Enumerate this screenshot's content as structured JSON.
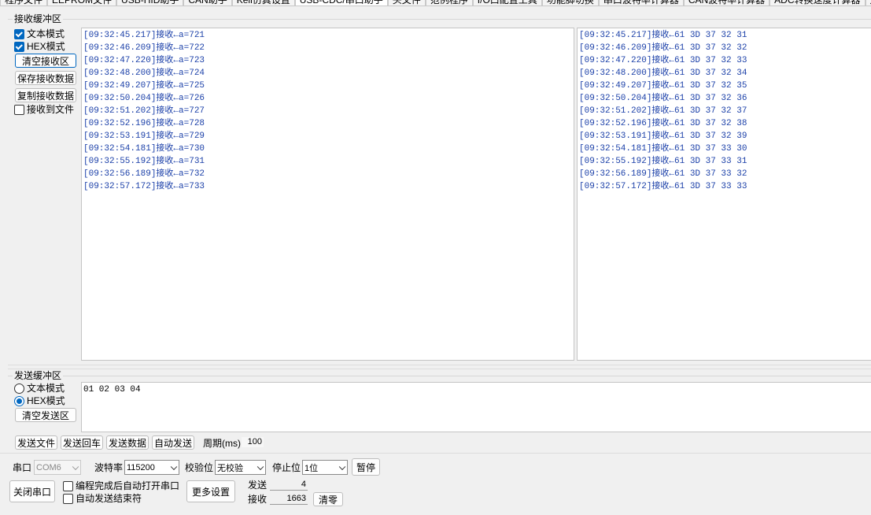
{
  "tabs": [
    "程序文件",
    "EEPROM文件",
    "USB-HID助手",
    "CAN助手",
    "Keil仿真设置",
    "USB-CDC/串口助手",
    "头文件",
    "范例程序",
    "I/O口配置工具",
    "功能脚切换",
    "串口波特率计算器",
    "CAN波特率计算器",
    "ADC转换速度计算器",
    "定时器计算"
  ],
  "active_tab_index": 5,
  "receive": {
    "group_title": "接收缓冲区",
    "text_mode_label": "文本模式",
    "text_mode_checked": true,
    "hex_mode_label": "HEX模式",
    "hex_mode_checked": true,
    "clear_button": "清空接收区",
    "save_button": "保存接收数据",
    "copy_button": "复制接收数据",
    "to_file_label": "接收到文件",
    "to_file_checked": false,
    "text_lines": [
      "[09:32:45.217]接收←a=721",
      "[09:32:46.209]接收←a=722",
      "[09:32:47.220]接收←a=723",
      "[09:32:48.200]接收←a=724",
      "[09:32:49.207]接收←a=725",
      "[09:32:50.204]接收←a=726",
      "[09:32:51.202]接收←a=727",
      "[09:32:52.196]接收←a=728",
      "[09:32:53.191]接收←a=729",
      "[09:32:54.181]接收←a=730",
      "[09:32:55.192]接收←a=731",
      "[09:32:56.189]接收←a=732",
      "[09:32:57.172]接收←a=733"
    ],
    "hex_lines": [
      "[09:32:45.217]接收←61 3D 37 32 31",
      "[09:32:46.209]接收←61 3D 37 32 32",
      "[09:32:47.220]接收←61 3D 37 32 33",
      "[09:32:48.200]接收←61 3D 37 32 34",
      "[09:32:49.207]接收←61 3D 37 32 35",
      "[09:32:50.204]接收←61 3D 37 32 36",
      "[09:32:51.202]接收←61 3D 37 32 37",
      "[09:32:52.196]接收←61 3D 37 32 38",
      "[09:32:53.191]接收←61 3D 37 32 39",
      "[09:32:54.181]接收←61 3D 37 33 30",
      "[09:32:55.192]接收←61 3D 37 33 31",
      "[09:32:56.189]接收←61 3D 37 33 32",
      "[09:32:57.172]接收←61 3D 37 33 33"
    ]
  },
  "send": {
    "group_title": "发送缓冲区",
    "text_mode_label": "文本模式",
    "hex_mode_label": "HEX模式",
    "selected_mode": "HEX模式",
    "clear_button": "清空发送区",
    "content": "01 02 03 04",
    "send_file_button": "发送文件",
    "send_cr_button": "发送回车",
    "send_data_button": "发送数据",
    "auto_send_button": "自动发送",
    "period_label": "周期(ms)",
    "period_value": "100"
  },
  "port": {
    "port_label": "串口",
    "port_value": "COM6",
    "baud_label": "波特率",
    "baud_value": "115200",
    "parity_label": "校验位",
    "parity_value": "无校验",
    "stop_label": "停止位",
    "stop_value": "1位",
    "pause_button": "暂停",
    "close_button": "关闭串口",
    "auto_open_label": "编程完成后自动打开串口",
    "auto_open_checked": false,
    "auto_end_label": "自动发送结束符",
    "auto_end_checked": false,
    "more_settings_button": "更多设置",
    "sent_label": "发送",
    "sent_count": "4",
    "recv_label": "接收",
    "recv_count": "1663",
    "clear_counts_button": "清零"
  }
}
